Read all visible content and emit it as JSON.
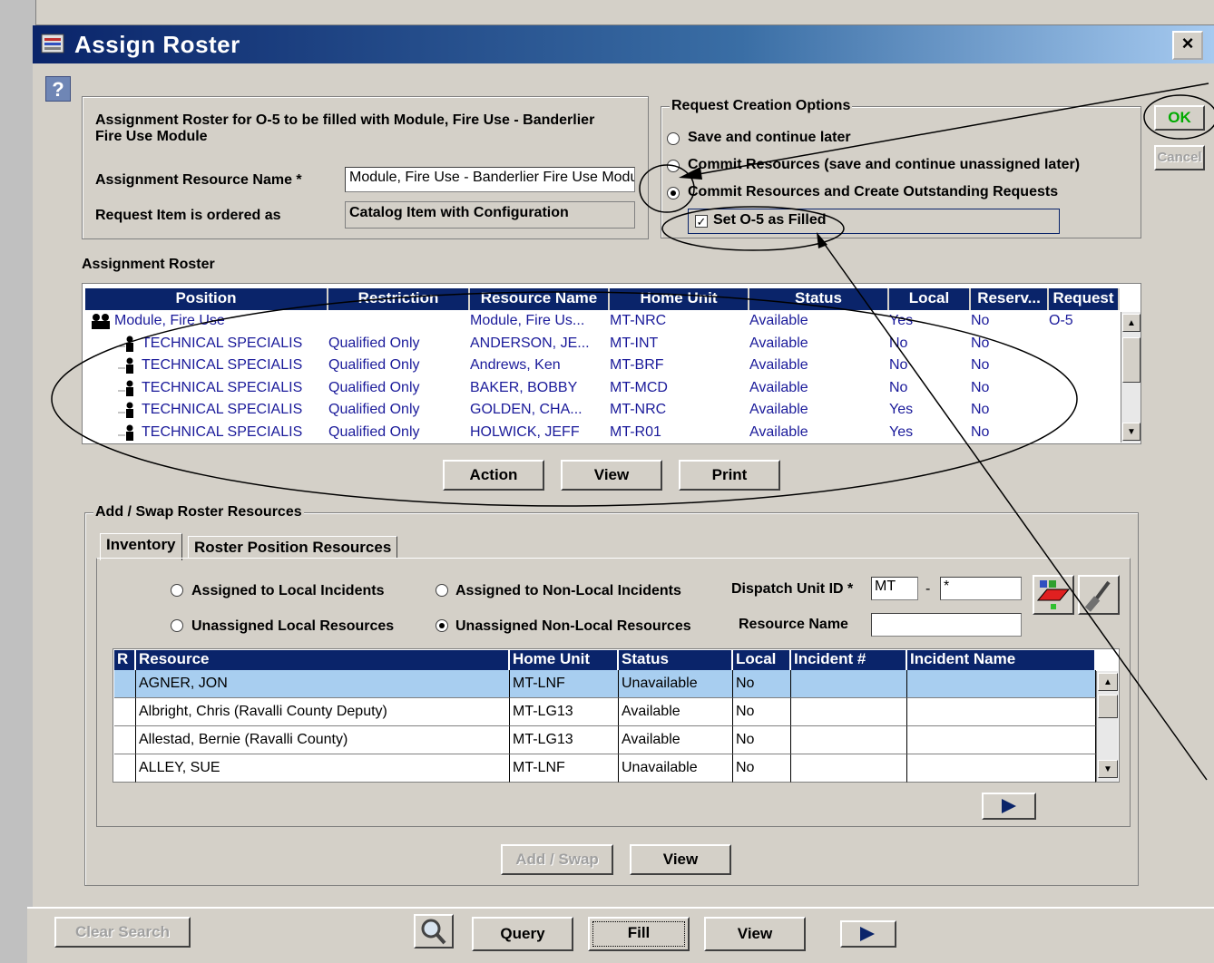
{
  "window": {
    "title": "Assign Roster",
    "close_label": "×"
  },
  "help_label": "?",
  "header": {
    "description": "Assignment Roster for O-5 to be filled with Module, Fire Use - Banderlier Fire Use Module",
    "resource_name_label": "Assignment Resource Name *",
    "resource_name_value": "Module, Fire Use - Banderlier Fire Use Module",
    "ordered_as_label": "Request Item is ordered as",
    "ordered_as_value": "Catalog Item with Configuration"
  },
  "request_options": {
    "title": "Request Creation Options",
    "options": [
      {
        "label": "Save and continue later",
        "selected": false
      },
      {
        "label": "Commit Resources (save and continue unassigned later)",
        "selected": false
      },
      {
        "label": "Commit Resources and Create Outstanding Requests",
        "selected": true
      }
    ],
    "checkbox_label": "Set O-5 as Filled",
    "checkbox_checked": true
  },
  "buttons_right": {
    "ok": "OK",
    "cancel": "Cancel"
  },
  "roster": {
    "title": "Assignment Roster",
    "columns": [
      "Position",
      "Restriction",
      "Resource Name",
      "Home Unit",
      "Status",
      "Local",
      "Reserv...",
      "Request"
    ],
    "rows": [
      {
        "position": "Module, Fire Use",
        "restriction": "",
        "name": "Module, Fire Us...",
        "unit": "MT-NRC",
        "status": "Available",
        "local": "Yes",
        "reserve": "No",
        "request": "O-5"
      },
      {
        "position": "TECHNICAL SPECIALIS",
        "restriction": "Qualified Only",
        "name": "ANDERSON, JE...",
        "unit": "MT-INT",
        "status": "Available",
        "local": "No",
        "reserve": "No",
        "request": ""
      },
      {
        "position": "TECHNICAL SPECIALIS",
        "restriction": "Qualified Only",
        "name": "Andrews, Ken",
        "unit": "MT-BRF",
        "status": "Available",
        "local": "No",
        "reserve": "No",
        "request": ""
      },
      {
        "position": "TECHNICAL SPECIALIS",
        "restriction": "Qualified Only",
        "name": "BAKER, BOBBY",
        "unit": "MT-MCD",
        "status": "Available",
        "local": "No",
        "reserve": "No",
        "request": ""
      },
      {
        "position": "TECHNICAL SPECIALIS",
        "restriction": "Qualified Only",
        "name": "GOLDEN, CHA...",
        "unit": "MT-NRC",
        "status": "Available",
        "local": "Yes",
        "reserve": "No",
        "request": ""
      },
      {
        "position": "TECHNICAL SPECIALIS",
        "restriction": "Qualified Only",
        "name": "HOLWICK, JEFF",
        "unit": "MT-R01",
        "status": "Available",
        "local": "Yes",
        "reserve": "No",
        "request": ""
      }
    ],
    "buttons": {
      "action": "Action",
      "view": "View",
      "print": "Print"
    }
  },
  "swap": {
    "title": "Add / Swap Roster Resources",
    "tabs": [
      "Inventory",
      "Roster Position Resources"
    ],
    "radios": [
      {
        "label": "Assigned to Local Incidents",
        "selected": false
      },
      {
        "label": "Assigned to Non-Local Incidents",
        "selected": false
      },
      {
        "label": "Unassigned Local Resources",
        "selected": false
      },
      {
        "label": "Unassigned Non-Local Resources",
        "selected": true
      }
    ],
    "dispatch_label": "Dispatch Unit ID *",
    "dispatch_value": "MT",
    "dispatch_sep": "-",
    "dispatch_value2": "*",
    "resource_name_label": "Resource Name",
    "resource_name_value": "",
    "columns": [
      "R",
      "Resource",
      "Home Unit",
      "Status",
      "Local",
      "Incident #",
      "Incident Name"
    ],
    "rows": [
      {
        "r": "",
        "name": "AGNER, JON",
        "unit": "MT-LNF",
        "status": "Unavailable",
        "local": "No",
        "incident": "",
        "incident_name": ""
      },
      {
        "r": "",
        "name": "Albright, Chris (Ravalli County Deputy)",
        "unit": "MT-LG13",
        "status": "Available",
        "local": "No",
        "incident": "",
        "incident_name": ""
      },
      {
        "r": "",
        "name": "Allestad, Bernie (Ravalli County)",
        "unit": "MT-LG13",
        "status": "Available",
        "local": "No",
        "incident": "",
        "incident_name": ""
      },
      {
        "r": "",
        "name": "ALLEY, SUE",
        "unit": "MT-LNF",
        "status": "Unavailable",
        "local": "No",
        "incident": "",
        "incident_name": ""
      }
    ],
    "add_swap": "Add / Swap",
    "view": "View"
  },
  "bottom": {
    "clear_search": "Clear Search",
    "query": "Query",
    "fill": "Fill",
    "view": "View"
  }
}
